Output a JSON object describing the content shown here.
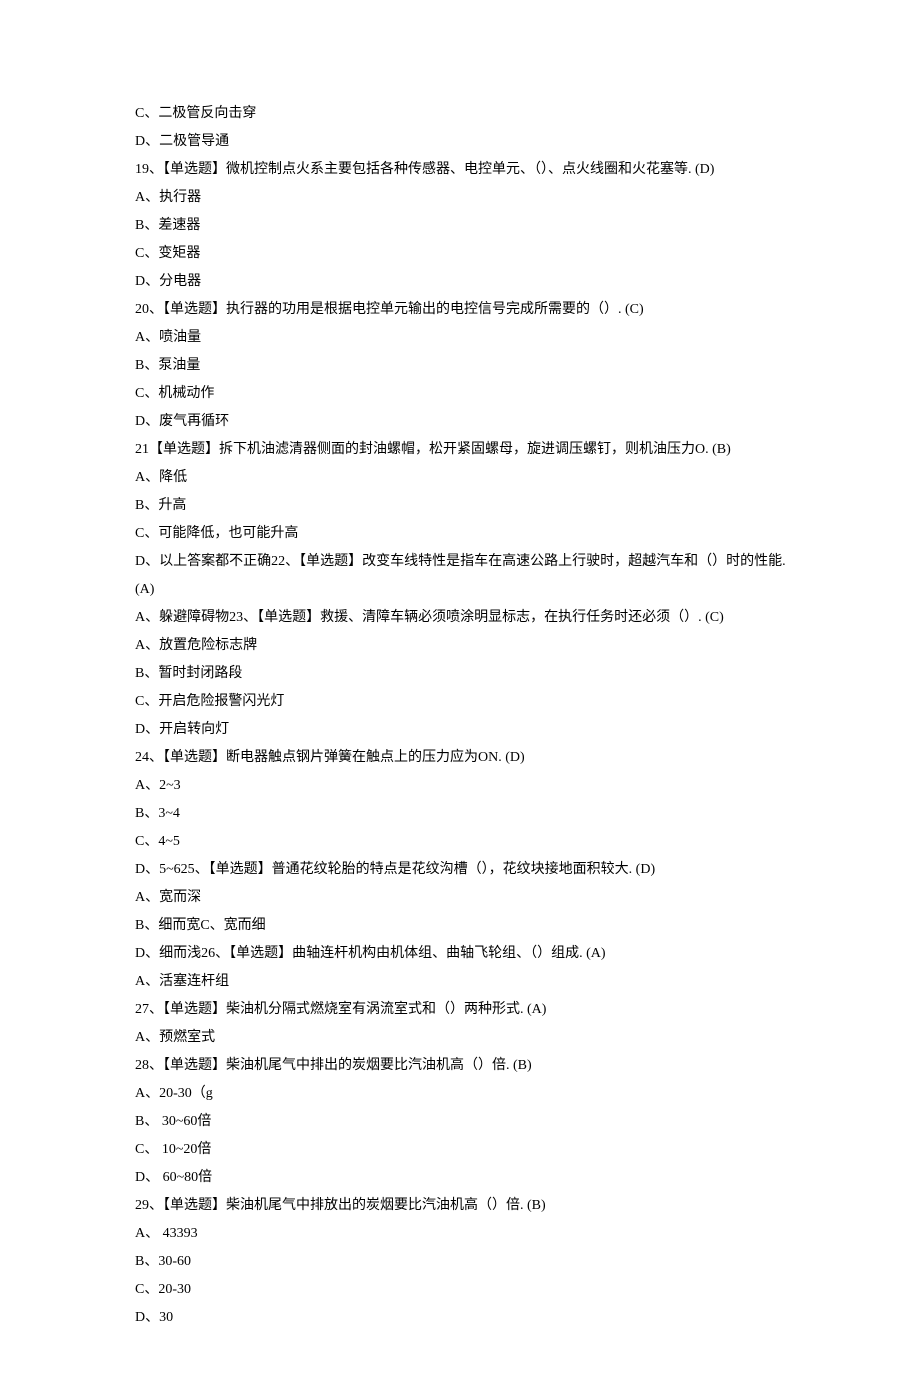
{
  "lines": [
    "C、二极管反向击穿",
    "D、二极管导通",
    "19、【单选题】微机控制点火系主要包括各种传感器、电控单元、（）、点火线圈和火花塞等. (D)",
    "A、执行器",
    "B、差速器",
    "C、变矩器",
    "D、分电器",
    "20、【单选题】执行器的功用是根据电控单元输出的电控信号完成所需要的（）. (C)",
    "A、喷油量",
    "B、泵油量",
    "C、机械动作",
    "D、废气再循环",
    "21【单选题】拆下机油滤清器侧面的封油螺帽，松开紧固螺母，旋进调压螺钉，则机油压力O. (B)",
    "A、降低",
    "B、升高",
    "C、可能降低，也可能升高",
    "D、以上答案都不正确22、【单选题】改变车线特性是指车在高速公路上行驶时，超越汽车和（）时的性能. (A)",
    "A、躲避障碍物23、【单选题】救援、清障车辆必须喷涂明显标志，在执行任务时还必须（）. (C)",
    "A、放置危险标志牌",
    "B、暂时封闭路段",
    "C、开启危险报警闪光灯",
    "D、开启转向灯",
    "24、【单选题】断电器触点钢片弹簧在触点上的压力应为ON. (D)",
    "A、2~3",
    "B、3~4",
    "C、4~5",
    "D、5~625、【单选题】普通花纹轮胎的特点是花纹沟槽（），花纹块接地面积较大. (D)",
    "A、宽而深",
    "B、细而宽C、宽而细",
    "D、细而浅26、【单选题】曲轴连杆机构由机体组、曲轴飞轮组、（）组成. (A)",
    "A、活塞连杆组",
    "27、【单选题】柴油机分隔式燃烧室有涡流室式和（）两种形式. (A)",
    "A、预燃室式",
    "28、【单选题】柴油机尾气中排出的炭烟要比汽油机高（）倍. (B)",
    "A、20-30（g",
    "B、 30~60倍",
    "C、 10~20倍",
    "D、 60~80倍",
    "29、【单选题】柴油机尾气中排放出的炭烟要比汽油机高（）倍. (B)",
    "A、 43393",
    "B、30-60",
    "C、20-30",
    "D、30"
  ]
}
